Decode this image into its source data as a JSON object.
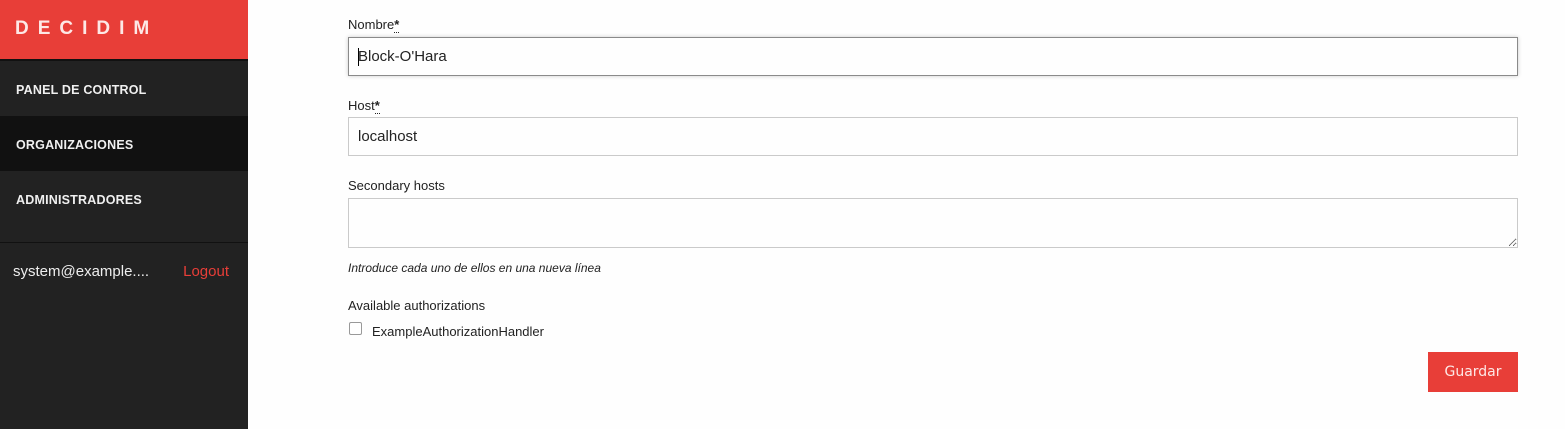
{
  "sidebar": {
    "logo": "DECIDIM",
    "items": [
      {
        "label": "PANEL DE CONTROL"
      },
      {
        "label": "ORGANIZACIONES"
      },
      {
        "label": "ADMINISTRADORES"
      }
    ],
    "user_email": "system@example....",
    "logout": "Logout"
  },
  "form": {
    "name": {
      "label": "Nombre",
      "required": "*",
      "value": "Block-O'Hara"
    },
    "host": {
      "label": "Host",
      "required": "*",
      "value": "localhost"
    },
    "secondary_hosts": {
      "label": "Secondary hosts",
      "value": "",
      "help": "Introduce cada uno de ellos en una nueva línea"
    },
    "authorizations": {
      "label": "Available authorizations",
      "options": [
        {
          "label": "ExampleAuthorizationHandler",
          "checked": false
        }
      ]
    },
    "submit": "Guardar"
  },
  "colors": {
    "brand": "#e83e38",
    "sidebar": "#222222"
  }
}
